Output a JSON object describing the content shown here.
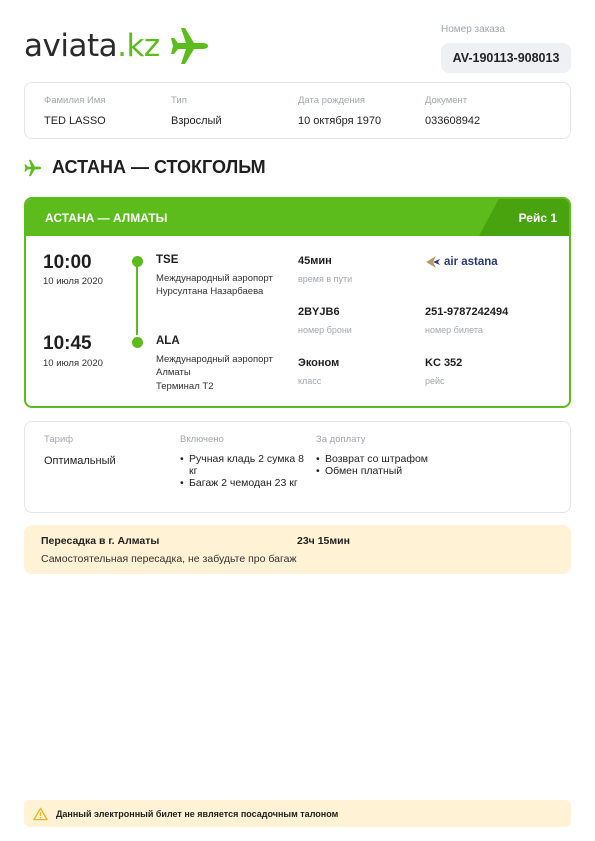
{
  "brand": {
    "name_main": "aviata",
    "name_suffix": ".kz",
    "accent": "#5cbc1c",
    "icon": "airplane-icon"
  },
  "order": {
    "label": "Номер заказа",
    "number": "AV-190113-908013"
  },
  "passenger": {
    "name_label": "Фамилия Имя",
    "name": "TED LASSO",
    "type_label": "Тип",
    "type": "Взрослый",
    "dob_label": "Дата рождения",
    "dob": "10 октября 1970",
    "doc_label": "Документ",
    "doc": "033608942"
  },
  "route_title": "АСТАНА — СТОКГОЛЬМ",
  "flight": {
    "segment": "АСТАНА — АЛМАТЫ",
    "flight_tag": "Рейс 1",
    "departure": {
      "time": "10:00",
      "date": "10 июля 2020",
      "code": "TSE",
      "airport": "Международный аэропорт Нурсултана Назарбаева"
    },
    "arrival": {
      "time": "10:45",
      "date": "10 июля 2020",
      "code": "ALA",
      "airport": "Международный аэропорт Алматы",
      "terminal": "Терминал Т2"
    },
    "duration": "45мин",
    "duration_label": "время в пути",
    "booking": "2BYJB6",
    "booking_label": "номер брони",
    "ticket": "251-9787242494",
    "ticket_label": "номер билета",
    "class": "Эконом",
    "class_label": "класс",
    "flight_no": "KC 352",
    "flight_no_label": "рейс",
    "airline": "air astana"
  },
  "tariff": {
    "label": "Тариф",
    "value": "Оптимальный",
    "included_label": "Включено",
    "included": [
      "Ручная кладь 2 сумка 8 кг",
      "Багаж 2 чемодан 23 кг"
    ],
    "extra_label": "За доплату",
    "extra": [
      "Возврат со штрафом",
      "Обмен платный"
    ]
  },
  "transfer": {
    "title": "Пересадка в г. Алматы",
    "duration": "23ч 15мин",
    "note": "Самостоятельная пересадка, не забудьте про багаж"
  },
  "notice": {
    "icon": "warning-icon",
    "text": "Данный электронный билет не является посадочным талоном"
  }
}
